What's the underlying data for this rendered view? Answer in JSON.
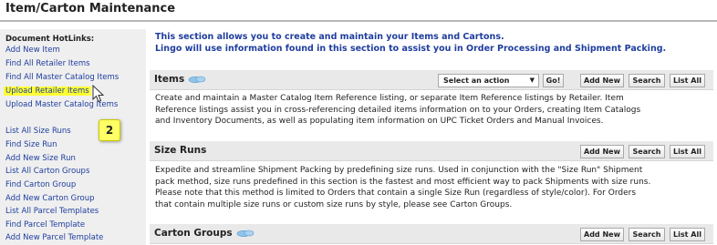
{
  "page": {
    "title": "Item/Carton Maintenance"
  },
  "sidebar": {
    "title": "Document HotLinks:",
    "links": [
      {
        "label": "Add New Item"
      },
      {
        "label": "Find All Retailer Items"
      },
      {
        "label": "Find All Master Catalog Items"
      },
      {
        "label": "Upload Retailer Items",
        "highlighted": true
      },
      {
        "label": "Upload Master Catalog Items"
      },
      {
        "label": "List All Size Runs"
      },
      {
        "label": "Find Size Run"
      },
      {
        "label": "Add New Size Run"
      },
      {
        "label": "List All Carton Groups"
      },
      {
        "label": "Find Carton Group"
      },
      {
        "label": "Add New Carton Group"
      },
      {
        "label": "List All Parcel Templates"
      },
      {
        "label": "Find Parcel Template"
      },
      {
        "label": "Add New Parcel Template"
      }
    ]
  },
  "callout": {
    "step": "2"
  },
  "intro": {
    "line1": "This section allows you to create and maintain your Items and Cartons.",
    "line2": "Lingo will use information found in this section to assist you in Order Processing and Shipment Packing."
  },
  "sections": {
    "items": {
      "title": "Items",
      "select_value": "Select an action",
      "go_label": "Go!",
      "add_new_label": "Add New",
      "search_label": "Search",
      "list_all_label": "List All",
      "lines": [
        "Create and maintain a Master Catalog Item Reference listing, or separate Item Reference listings by Retailer. Item",
        "Reference listings assist you in cross-referencing detailed items information on to your Orders, creating Item Catalogs",
        "and Inventory Documents, as well as populating item information on UPC Ticket Orders and Manual Invoices."
      ]
    },
    "size_runs": {
      "title": "Size Runs",
      "add_new_label": "Add New",
      "search_label": "Search",
      "list_all_label": "List All",
      "lines": [
        "Expedite and streamline Shipment Packing by predefining size runs. Used in conjunction with the \"Size Run\" Shipment",
        "pack method, size runs predefined in this section is the fastest and most efficient way to pack Shipments with size runs.",
        "Please note that this method is limited to Orders that contain a single Size Run (regardless of style/color). For Orders",
        "that contain multiple size runs or custom size runs by style, please see Carton Groups."
      ]
    },
    "carton_groups": {
      "title": "Carton Groups",
      "add_new_label": "Add New",
      "search_label": "Search",
      "list_all_label": "List All"
    }
  },
  "colors": {
    "link": "#1f3e9e",
    "highlight": "#ffff33",
    "section_bar": "#e9e9e9",
    "sidebar": "#efefef"
  }
}
